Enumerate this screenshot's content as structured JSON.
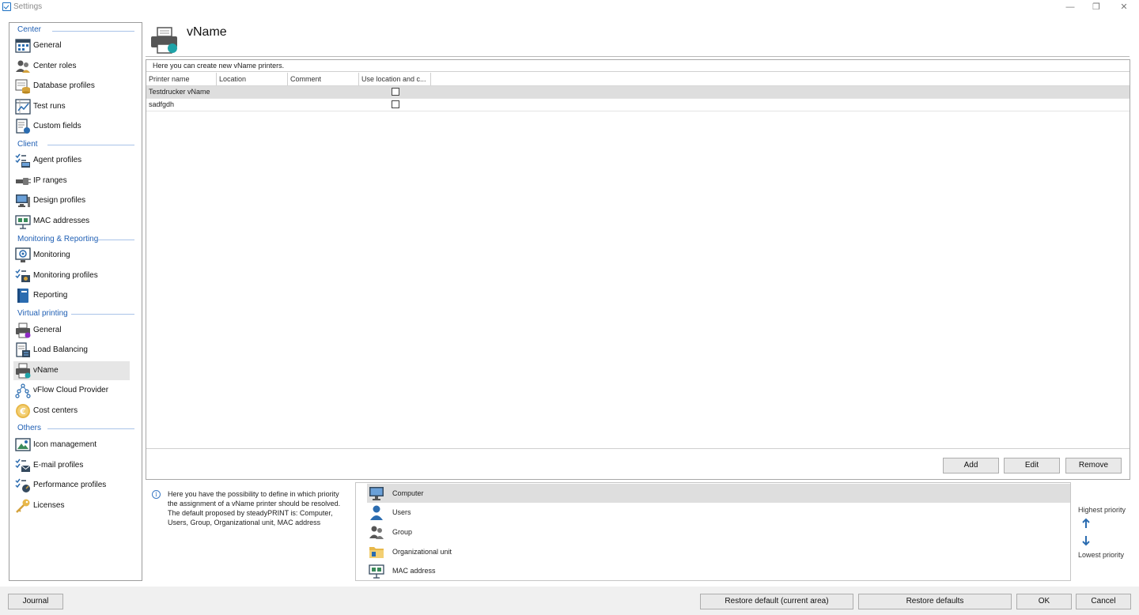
{
  "window": {
    "title": "Settings",
    "minimize": "—",
    "restore": "❐",
    "close": "✕"
  },
  "sidebar": {
    "sections": [
      {
        "header": "Center",
        "items": [
          {
            "label": "General",
            "icon": "calendar-grid-icon"
          },
          {
            "label": "Center roles",
            "icon": "users-icon"
          },
          {
            "label": "Database profiles",
            "icon": "database-profile-icon"
          },
          {
            "label": "Test runs",
            "icon": "chart-icon"
          },
          {
            "label": "Custom fields",
            "icon": "custom-fields-icon"
          }
        ]
      },
      {
        "header": "Client",
        "items": [
          {
            "label": "Agent profiles",
            "icon": "agent-profile-icon"
          },
          {
            "label": "IP ranges",
            "icon": "network-cable-icon"
          },
          {
            "label": "Design profiles",
            "icon": "design-monitor-icon"
          },
          {
            "label": "MAC addresses",
            "icon": "network-card-icon"
          }
        ]
      },
      {
        "header": "Monitoring & Reporting",
        "items": [
          {
            "label": "Monitoring",
            "icon": "monitoring-icon"
          },
          {
            "label": "Monitoring profiles",
            "icon": "monitoring-profile-icon"
          },
          {
            "label": "Reporting",
            "icon": "book-icon"
          }
        ]
      },
      {
        "header": "Virtual printing",
        "items": [
          {
            "label": "General",
            "icon": "printer-purple-icon"
          },
          {
            "label": "Load Balancing",
            "icon": "load-balancing-icon"
          },
          {
            "label": "vName",
            "icon": "printer-teal-icon",
            "active": true
          },
          {
            "label": "vFlow Cloud Provider",
            "icon": "network-nodes-icon"
          },
          {
            "label": "Cost centers",
            "icon": "euro-coin-icon"
          }
        ]
      },
      {
        "header": "Others",
        "items": [
          {
            "label": "Icon management",
            "icon": "image-icon"
          },
          {
            "label": "E-mail profiles",
            "icon": "email-profile-icon"
          },
          {
            "label": "Performance profiles",
            "icon": "performance-profile-icon"
          },
          {
            "label": "Licenses",
            "icon": "key-icon"
          }
        ]
      }
    ]
  },
  "page": {
    "title": "vName",
    "icon": "printer-teal-icon"
  },
  "table": {
    "hint": "Here you can create new vName printers.",
    "columns": [
      "Printer name",
      "Location",
      "Comment",
      "Use location and c..."
    ],
    "rows": [
      {
        "name": "Testdrucker vName",
        "use_location": false,
        "selected": true
      },
      {
        "name": "sadfgdh",
        "use_location": false,
        "selected": false
      }
    ]
  },
  "buttons": {
    "add": "Add",
    "edit": "Edit",
    "remove": "Remove"
  },
  "priority": {
    "info_lines": [
      "Here you have the possibility to define in which priority",
      "the assignment of a  vName printer should be resolved.",
      "The default proposed by steadyPRINT is: Computer,",
      "Users, Group, Organizational unit, MAC address"
    ],
    "items": [
      {
        "label": "Computer",
        "icon": "computer-icon",
        "selected": true
      },
      {
        "label": "Users",
        "icon": "user-icon"
      },
      {
        "label": "Group",
        "icon": "group-icon"
      },
      {
        "label": "Organizational unit",
        "icon": "folder-icon"
      },
      {
        "label": "MAC address",
        "icon": "network-card-icon"
      }
    ],
    "highest": "Highest priority",
    "lowest": "Lowest priority"
  },
  "footer": {
    "journal": "Journal",
    "restore_current": "Restore default (current area)",
    "restore_all": "Restore defaults",
    "ok": "OK",
    "cancel": "Cancel"
  },
  "colors": {
    "accent": "#1f5fb4",
    "selection": "#dedede",
    "teal": "#1fa3a8"
  }
}
